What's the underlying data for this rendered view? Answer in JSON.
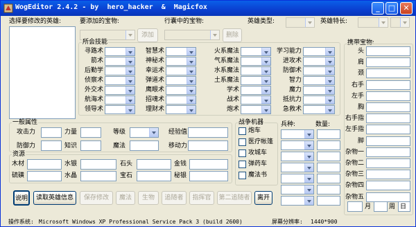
{
  "window": {
    "title": "WogEditor 2.4.2 - by  hero_hacker  &  Magicfox",
    "minimize_glyph": "_",
    "maximize_glyph": "□",
    "close_glyph": "✕",
    "accent": "#0a3fd0",
    "close_color": "#c8411f"
  },
  "top": {
    "hero_select_label": "选择要修改的英雄:",
    "artifact_add_label": "要添加的宝物:",
    "add_button": "添加",
    "pack_artifact_label": "行囊中的宝物:",
    "delete_button": "删除",
    "hero_type_label": "英雄类型:",
    "hero_specialty_label": "英雄特长:"
  },
  "skills": {
    "group_label": "所会技能",
    "columns": [
      [
        "寻路术",
        "箭术",
        "后勤学",
        "侦察术",
        "外交术",
        "航海术",
        "领导术"
      ],
      [
        "智慧术",
        "神秘术",
        "幸运术",
        "弹道术",
        "鹰眼术",
        "招魂术",
        "理财术"
      ],
      [
        "火系魔法",
        "气系魔法",
        "水系魔法",
        "土系魔法",
        "学术",
        "战术",
        "炮术"
      ],
      [
        "学习能力",
        "进攻术",
        "防御术",
        "智力",
        "魔力",
        "抵抗力",
        "急救术"
      ]
    ]
  },
  "carried": {
    "group_label": "携带宝物:",
    "slots": [
      "头",
      "肩",
      "颈",
      "右手",
      "左手",
      "胸",
      "右手指",
      "左手指",
      "脚",
      "杂物一",
      "杂物二",
      "杂物三",
      "杂物四",
      "杂物五"
    ],
    "month_label": "月",
    "week_label": "周",
    "day_label": "日"
  },
  "attributes": {
    "group_label": "一般属性",
    "attack": "攻击力",
    "power": "力量",
    "level": "等级",
    "experience": "经验值",
    "defense": "防御力",
    "knowledge": "知识",
    "mana": "魔法",
    "movement": "移动力"
  },
  "resources": {
    "group_label": "资源",
    "wood": "木材",
    "mercury": "水银",
    "ore": "石头",
    "gold": "金钱",
    "sulfur": "硫磺",
    "crystal": "水晶",
    "gems": "宝石",
    "mithril": "秘银"
  },
  "war_machines": {
    "group_label": "战争机器",
    "items": [
      "炮车",
      "医疗帐篷",
      "攻城车",
      "弹药车",
      "魔法书"
    ]
  },
  "army": {
    "troop_label": "兵种:",
    "count_label": "数量:"
  },
  "buttons": {
    "help": "说明",
    "read": "读取英雄信息",
    "save": "保存修改",
    "magic": "魔法",
    "creatures": "生物",
    "chaser": "追随者",
    "commander": "指挥官",
    "second_chaser": "第二追随者",
    "exit": "离开"
  },
  "status": {
    "os_label": "操作系统:",
    "os_value": "Microsoft Windows XP Professional Service Pack 3 (build 2600)",
    "res_label": "屏幕分辨率:",
    "res_value": "1440*900"
  }
}
